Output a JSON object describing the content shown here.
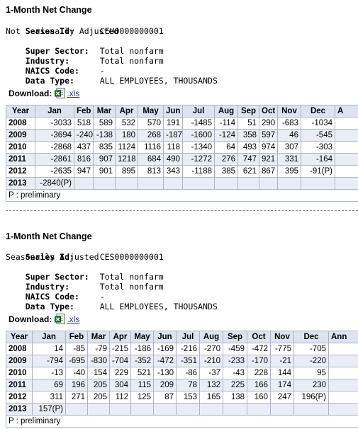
{
  "sections": [
    {
      "heading": "1-Month Net Change",
      "series_id_label": "Series Id:",
      "series_id": "CEU0000000001",
      "seasonal": "Not Seasonally Adjusted",
      "super_sector_label": "Super Sector:",
      "super_sector": "Total nonfarm",
      "industry_label": "Industry:",
      "industry": "Total nonfarm",
      "naics_label": "NAICS Code:",
      "naics": "-",
      "data_type_label": "Data Type:",
      "data_type": "ALL EMPLOYEES, THOUSANDS",
      "download_label": "Download:",
      "download_icon": "excel-file-icon",
      "xls_link": ".xls",
      "columns": [
        "Year",
        "Jan",
        "Feb",
        "Mar",
        "Apr",
        "May",
        "Jun",
        "Jul",
        "Aug",
        "Sep",
        "Oct",
        "Nov",
        "Dec",
        "A"
      ],
      "rows": [
        [
          "2008",
          "-3033",
          "518",
          "589",
          "532",
          "570",
          "191",
          "-1485",
          "-114",
          "51",
          "290",
          "-683",
          "-1034"
        ],
        [
          "2009",
          "-3694",
          "-240",
          "-138",
          "180",
          "268",
          "-187",
          "-1600",
          "-124",
          "358",
          "597",
          "46",
          "-545"
        ],
        [
          "2010",
          "-2868",
          "437",
          "835",
          "1124",
          "1116",
          "118",
          "-1340",
          "64",
          "493",
          "974",
          "307",
          "-303"
        ],
        [
          "2011",
          "-2861",
          "816",
          "907",
          "1218",
          "684",
          "490",
          "-1272",
          "276",
          "747",
          "921",
          "331",
          "-164"
        ],
        [
          "2012",
          "-2635",
          "947",
          "901",
          "895",
          "813",
          "343",
          "-1188",
          "385",
          "621",
          "867",
          "395",
          "-91(P)"
        ],
        [
          "2013",
          "-2840(P)",
          "",
          "",
          "",
          "",
          "",
          "",
          "",
          "",
          "",
          "",
          ""
        ]
      ],
      "footnote": "P : preliminary"
    },
    {
      "heading": "1-Month Net Change",
      "series_id_label": "Series Id:",
      "series_id": "CES0000000001",
      "seasonal": "Seasonally Adjusted",
      "super_sector_label": "Super Sector:",
      "super_sector": "Total nonfarm",
      "industry_label": "Industry:",
      "industry": "Total nonfarm",
      "naics_label": "NAICS Code:",
      "naics": "-",
      "data_type_label": "Data Type:",
      "data_type": "ALL EMPLOYEES, THOUSANDS",
      "download_label": "Download:",
      "download_icon": "excel-file-icon",
      "xls_link": ".xls",
      "columns": [
        "Year",
        "Jan",
        "Feb",
        "Mar",
        "Apr",
        "May",
        "Jun",
        "Jul",
        "Aug",
        "Sep",
        "Oct",
        "Nov",
        "Dec",
        "Ann"
      ],
      "rows": [
        [
          "2008",
          "14",
          "-85",
          "-79",
          "-215",
          "-186",
          "-169",
          "-216",
          "-270",
          "-459",
          "-472",
          "-775",
          "-705"
        ],
        [
          "2009",
          "-794",
          "-695",
          "-830",
          "-704",
          "-352",
          "-472",
          "-351",
          "-210",
          "-233",
          "-170",
          "-21",
          "-220"
        ],
        [
          "2010",
          "-13",
          "-40",
          "154",
          "229",
          "521",
          "-130",
          "-86",
          "-37",
          "-43",
          "228",
          "144",
          "95"
        ],
        [
          "2011",
          "69",
          "196",
          "205",
          "304",
          "115",
          "209",
          "78",
          "132",
          "225",
          "166",
          "174",
          "230"
        ],
        [
          "2012",
          "311",
          "271",
          "205",
          "112",
          "125",
          "87",
          "153",
          "165",
          "138",
          "160",
          "247",
          "196(P)"
        ],
        [
          "2013",
          "157(P)",
          "",
          "",
          "",
          "",
          "",
          "",
          "",
          "",
          "",
          "",
          ""
        ]
      ],
      "footnote": "P : preliminary"
    }
  ]
}
